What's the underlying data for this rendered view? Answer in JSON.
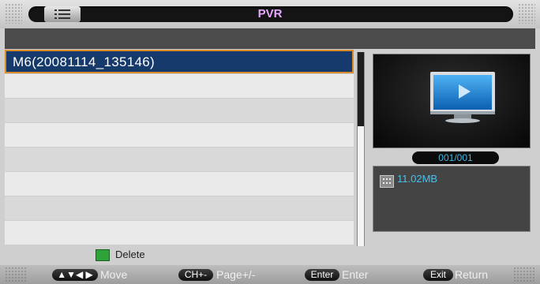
{
  "header": {
    "title": "PVR",
    "menu_icon": "list-icon"
  },
  "recordings": {
    "items": [
      {
        "label": "M6(20081114_135146)",
        "selected": true
      },
      {
        "label": ""
      },
      {
        "label": ""
      },
      {
        "label": ""
      },
      {
        "label": ""
      },
      {
        "label": ""
      },
      {
        "label": ""
      },
      {
        "label": ""
      }
    ]
  },
  "preview": {
    "counter": "001/001",
    "file_size": "11.02MB",
    "size_icon": "storage-icon",
    "thumbnail_icon": "tv-play-icon"
  },
  "legend": {
    "color": "#2fa33a",
    "label": "Delete"
  },
  "footer": {
    "move_key": "▲▼◀ ▶",
    "move_label": "Move",
    "page_key": "CH+-",
    "page_label": "Page+/-",
    "enter_key": "Enter",
    "enter_label": "Enter",
    "exit_key": "Exit",
    "exit_label": "Return"
  },
  "colors": {
    "accent_text": "#48c1ef",
    "selection_bg": "#163a6c",
    "selection_border": "#d88c2c",
    "title": "#e7a7ff"
  }
}
